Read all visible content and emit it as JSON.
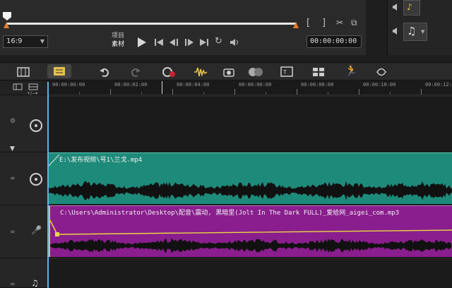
{
  "player": {
    "aspect_ratio": "16:9",
    "mode_label_project": "项目",
    "mode_label_clip": "素材",
    "timecode": "00:00:00:00"
  },
  "toolbar": {
    "buttons": [
      "timeline-view",
      "storyboard-view",
      "undo",
      "redo",
      "record-capture",
      "sound-mixer",
      "auto-music",
      "motion-tracking",
      "subtitle-editor",
      "multi-camera",
      "time-remapping",
      "mask-creator"
    ]
  },
  "ruler": {
    "labels": [
      "00:00:00:00",
      "00:00:02:00",
      "00:00:04:00",
      "00:00:06:00",
      "00:00:08:00",
      "00:00:10:00",
      "00:00:12:0"
    ]
  },
  "tracks": {
    "video_clip_name": "E:\\发布视频\\号1\\兰戈.mp4",
    "audio_clip_name": "C:\\Users\\Administrator\\Desktop\\配音\\震动, 黑暗里(Jolt In The Dark FULL)_爱给网_aigei_com.mp3"
  },
  "colors": {
    "video_clip": "#1e8a7a",
    "audio_clip": "#8a1e8e",
    "marker": "#e8782a",
    "playhead": "#5ab4e8",
    "volume_line": "#e8d840"
  }
}
